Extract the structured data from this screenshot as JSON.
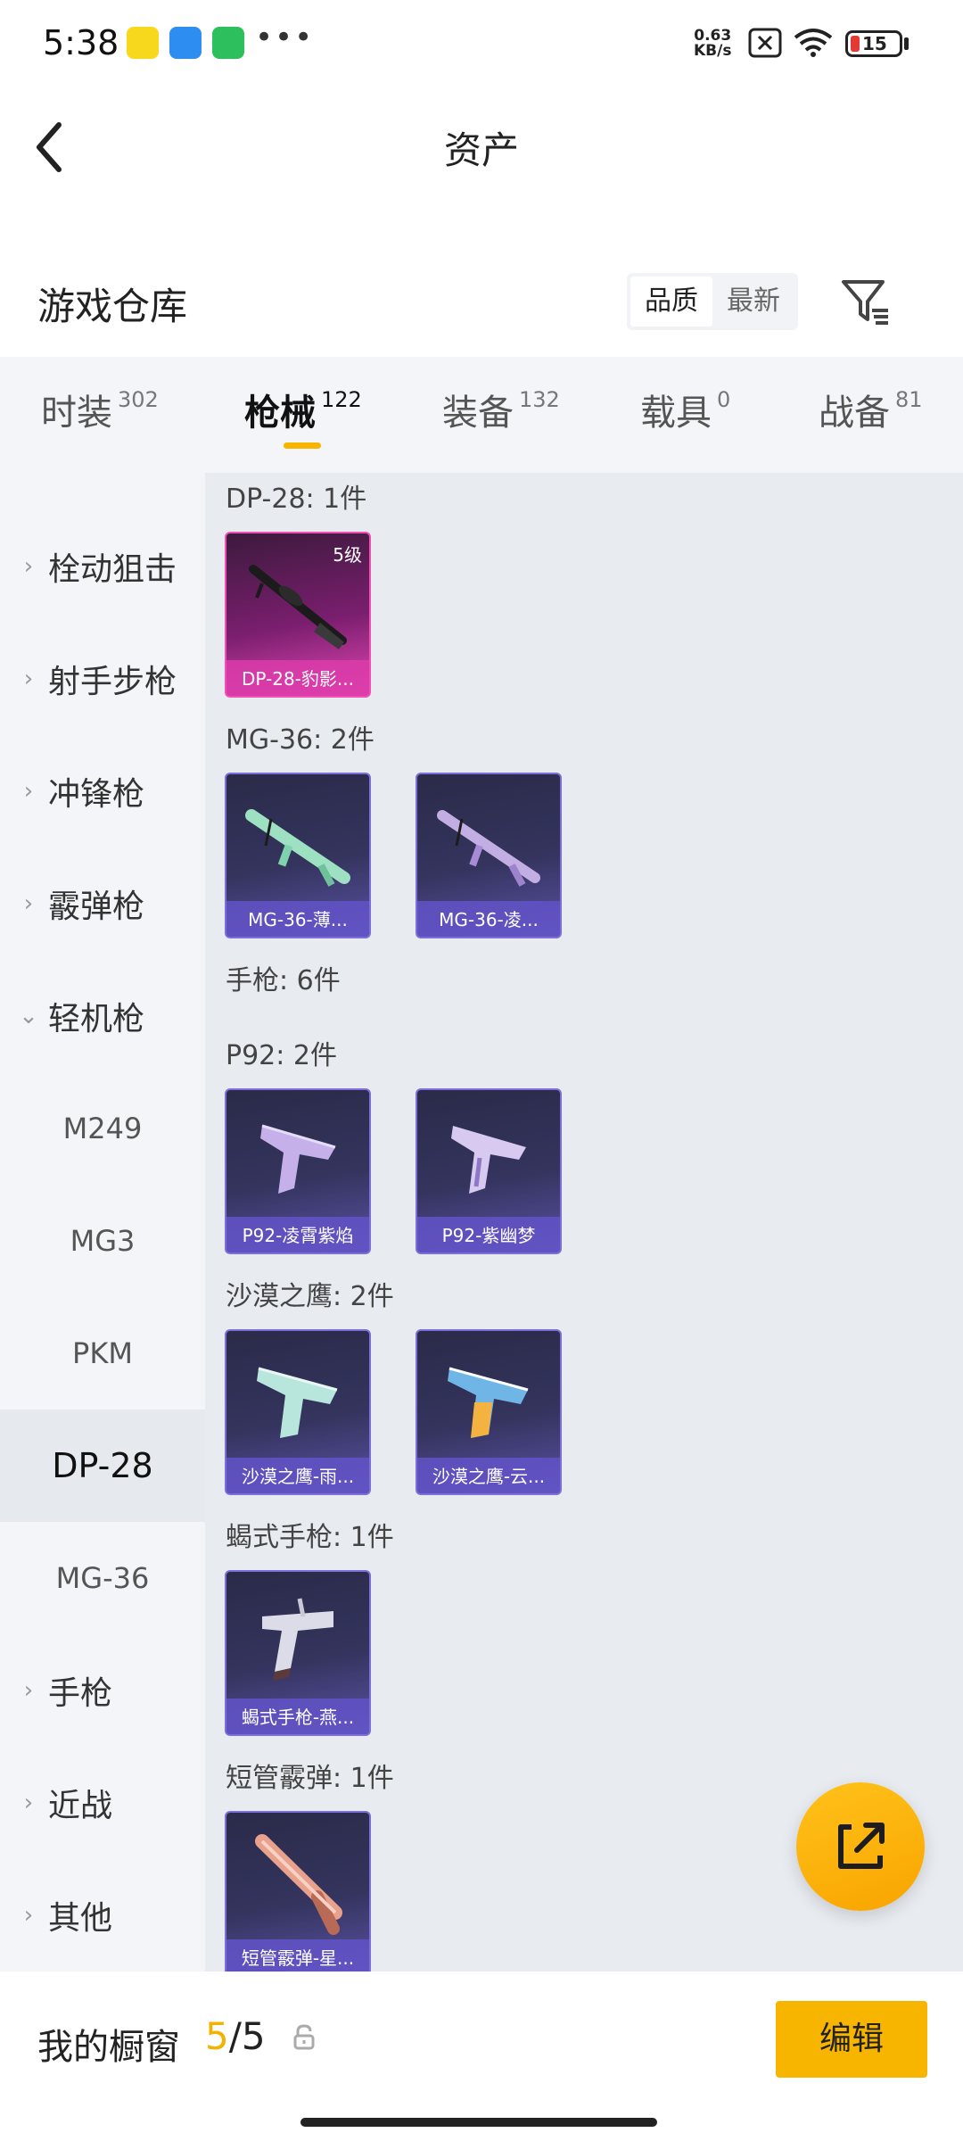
{
  "status_bar": {
    "time": "5:38",
    "net_speed_value": "0.63",
    "net_speed_unit": "KB/s",
    "battery": "15"
  },
  "header": {
    "title": "资产"
  },
  "warehouse": {
    "title": "游戏仓库",
    "sort_options": [
      "品质",
      "最新"
    ]
  },
  "tabs": [
    {
      "label": "时装",
      "count": "302"
    },
    {
      "label": "枪械",
      "count": "122"
    },
    {
      "label": "装备",
      "count": "132"
    },
    {
      "label": "载具",
      "count": "0"
    },
    {
      "label": "战备",
      "count": "81"
    }
  ],
  "sidebar": {
    "categories": [
      "栓动狙击",
      "射手步枪",
      "冲锋枪",
      "霰弹枪",
      "轻机枪"
    ],
    "lmg_items": [
      "M249",
      "MG3",
      "PKM",
      "DP-28",
      "MG-36"
    ],
    "more_categories": [
      "手枪",
      "近战",
      "其他"
    ]
  },
  "content": {
    "groups": [
      "DP-28: 1件",
      "MG-36: 2件",
      "手枪: 6件",
      "P92: 2件",
      "沙漠之鹰: 2件",
      "蝎式手枪: 1件",
      "短管霰弹: 1件"
    ],
    "cards": [
      {
        "label": "DP-28-豹影...",
        "badge": "5级"
      },
      {
        "label": "MG-36-薄..."
      },
      {
        "label": "MG-36-凌..."
      },
      {
        "label": "P92-凌霄紫焰"
      },
      {
        "label": "P92-紫幽梦"
      },
      {
        "label": "沙漠之鹰-雨..."
      },
      {
        "label": "沙漠之鹰-云..."
      },
      {
        "label": "蝎式手枪-燕..."
      },
      {
        "label": "短管霰弹-星..."
      }
    ]
  },
  "bottom": {
    "showcase_label": "我的橱窗",
    "showcase_used": "5",
    "showcase_sep": "/",
    "showcase_total": "5",
    "edit_label": "编辑"
  },
  "colors": {
    "accent": "#f7b500",
    "rarity_purple": "#7d6fd8",
    "rarity_pink": "#f24fb5"
  },
  "icons": [
    "back-arrow-icon",
    "filter-icon",
    "chevron-right-icon",
    "chevron-down-icon",
    "share-icon",
    "lock-icon",
    "wifi-icon",
    "sim-off-icon"
  ]
}
